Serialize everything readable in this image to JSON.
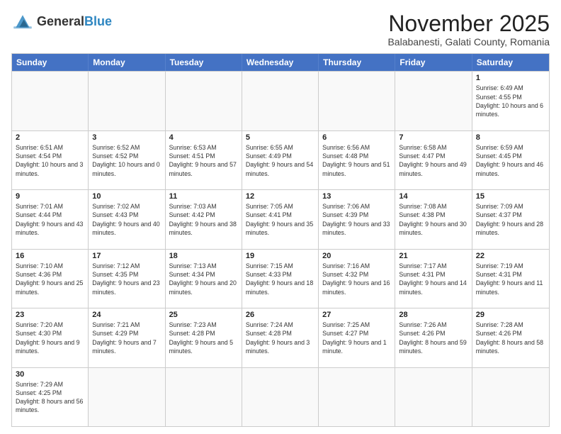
{
  "logo": {
    "text_general": "General",
    "text_blue": "Blue"
  },
  "title": "November 2025",
  "location": "Balabanesti, Galati County, Romania",
  "header_days": [
    "Sunday",
    "Monday",
    "Tuesday",
    "Wednesday",
    "Thursday",
    "Friday",
    "Saturday"
  ],
  "weeks": [
    [
      {
        "day": "",
        "info": ""
      },
      {
        "day": "",
        "info": ""
      },
      {
        "day": "",
        "info": ""
      },
      {
        "day": "",
        "info": ""
      },
      {
        "day": "",
        "info": ""
      },
      {
        "day": "",
        "info": ""
      },
      {
        "day": "1",
        "info": "Sunrise: 6:49 AM\nSunset: 4:55 PM\nDaylight: 10 hours and 6 minutes."
      }
    ],
    [
      {
        "day": "2",
        "info": "Sunrise: 6:51 AM\nSunset: 4:54 PM\nDaylight: 10 hours and 3 minutes."
      },
      {
        "day": "3",
        "info": "Sunrise: 6:52 AM\nSunset: 4:52 PM\nDaylight: 10 hours and 0 minutes."
      },
      {
        "day": "4",
        "info": "Sunrise: 6:53 AM\nSunset: 4:51 PM\nDaylight: 9 hours and 57 minutes."
      },
      {
        "day": "5",
        "info": "Sunrise: 6:55 AM\nSunset: 4:49 PM\nDaylight: 9 hours and 54 minutes."
      },
      {
        "day": "6",
        "info": "Sunrise: 6:56 AM\nSunset: 4:48 PM\nDaylight: 9 hours and 51 minutes."
      },
      {
        "day": "7",
        "info": "Sunrise: 6:58 AM\nSunset: 4:47 PM\nDaylight: 9 hours and 49 minutes."
      },
      {
        "day": "8",
        "info": "Sunrise: 6:59 AM\nSunset: 4:45 PM\nDaylight: 9 hours and 46 minutes."
      }
    ],
    [
      {
        "day": "9",
        "info": "Sunrise: 7:01 AM\nSunset: 4:44 PM\nDaylight: 9 hours and 43 minutes."
      },
      {
        "day": "10",
        "info": "Sunrise: 7:02 AM\nSunset: 4:43 PM\nDaylight: 9 hours and 40 minutes."
      },
      {
        "day": "11",
        "info": "Sunrise: 7:03 AM\nSunset: 4:42 PM\nDaylight: 9 hours and 38 minutes."
      },
      {
        "day": "12",
        "info": "Sunrise: 7:05 AM\nSunset: 4:41 PM\nDaylight: 9 hours and 35 minutes."
      },
      {
        "day": "13",
        "info": "Sunrise: 7:06 AM\nSunset: 4:39 PM\nDaylight: 9 hours and 33 minutes."
      },
      {
        "day": "14",
        "info": "Sunrise: 7:08 AM\nSunset: 4:38 PM\nDaylight: 9 hours and 30 minutes."
      },
      {
        "day": "15",
        "info": "Sunrise: 7:09 AM\nSunset: 4:37 PM\nDaylight: 9 hours and 28 minutes."
      }
    ],
    [
      {
        "day": "16",
        "info": "Sunrise: 7:10 AM\nSunset: 4:36 PM\nDaylight: 9 hours and 25 minutes."
      },
      {
        "day": "17",
        "info": "Sunrise: 7:12 AM\nSunset: 4:35 PM\nDaylight: 9 hours and 23 minutes."
      },
      {
        "day": "18",
        "info": "Sunrise: 7:13 AM\nSunset: 4:34 PM\nDaylight: 9 hours and 20 minutes."
      },
      {
        "day": "19",
        "info": "Sunrise: 7:15 AM\nSunset: 4:33 PM\nDaylight: 9 hours and 18 minutes."
      },
      {
        "day": "20",
        "info": "Sunrise: 7:16 AM\nSunset: 4:32 PM\nDaylight: 9 hours and 16 minutes."
      },
      {
        "day": "21",
        "info": "Sunrise: 7:17 AM\nSunset: 4:31 PM\nDaylight: 9 hours and 14 minutes."
      },
      {
        "day": "22",
        "info": "Sunrise: 7:19 AM\nSunset: 4:31 PM\nDaylight: 9 hours and 11 minutes."
      }
    ],
    [
      {
        "day": "23",
        "info": "Sunrise: 7:20 AM\nSunset: 4:30 PM\nDaylight: 9 hours and 9 minutes."
      },
      {
        "day": "24",
        "info": "Sunrise: 7:21 AM\nSunset: 4:29 PM\nDaylight: 9 hours and 7 minutes."
      },
      {
        "day": "25",
        "info": "Sunrise: 7:23 AM\nSunset: 4:28 PM\nDaylight: 9 hours and 5 minutes."
      },
      {
        "day": "26",
        "info": "Sunrise: 7:24 AM\nSunset: 4:28 PM\nDaylight: 9 hours and 3 minutes."
      },
      {
        "day": "27",
        "info": "Sunrise: 7:25 AM\nSunset: 4:27 PM\nDaylight: 9 hours and 1 minute."
      },
      {
        "day": "28",
        "info": "Sunrise: 7:26 AM\nSunset: 4:26 PM\nDaylight: 8 hours and 59 minutes."
      },
      {
        "day": "29",
        "info": "Sunrise: 7:28 AM\nSunset: 4:26 PM\nDaylight: 8 hours and 58 minutes."
      }
    ],
    [
      {
        "day": "30",
        "info": "Sunrise: 7:29 AM\nSunset: 4:25 PM\nDaylight: 8 hours and 56 minutes."
      },
      {
        "day": "",
        "info": ""
      },
      {
        "day": "",
        "info": ""
      },
      {
        "day": "",
        "info": ""
      },
      {
        "day": "",
        "info": ""
      },
      {
        "day": "",
        "info": ""
      },
      {
        "day": "",
        "info": ""
      }
    ]
  ]
}
